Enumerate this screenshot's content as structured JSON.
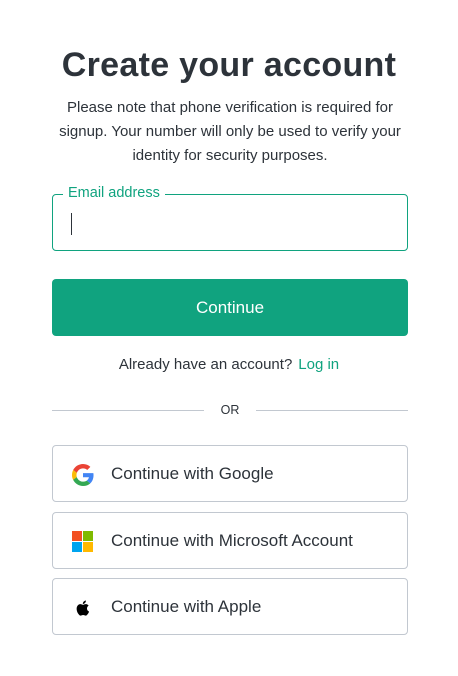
{
  "header": {
    "title": "Create your account",
    "subtitle": "Please note that phone verification is required for signup. Your number will only be used to verify your identity for security purposes."
  },
  "email": {
    "label": "Email address",
    "value": "",
    "placeholder": ""
  },
  "actions": {
    "continue_label": "Continue"
  },
  "login": {
    "prompt": "Already have an account?",
    "link_label": "Log in"
  },
  "divider": {
    "label": "OR"
  },
  "social": {
    "google_label": "Continue with Google",
    "microsoft_label": "Continue with Microsoft Account",
    "apple_label": "Continue with Apple"
  },
  "colors": {
    "accent": "#10a37f",
    "text": "#2d333a",
    "border": "#c2c8d0",
    "google_blue": "#4285F4",
    "google_green": "#34A853",
    "google_yellow": "#FBBC05",
    "google_red": "#EA4335",
    "ms_red": "#F25022",
    "ms_green": "#7FBA00",
    "ms_blue": "#00A4EF",
    "ms_yellow": "#FFB900"
  },
  "icons": {
    "google": "google-logo-icon",
    "microsoft": "microsoft-logo-icon",
    "apple": "apple-logo-icon"
  }
}
